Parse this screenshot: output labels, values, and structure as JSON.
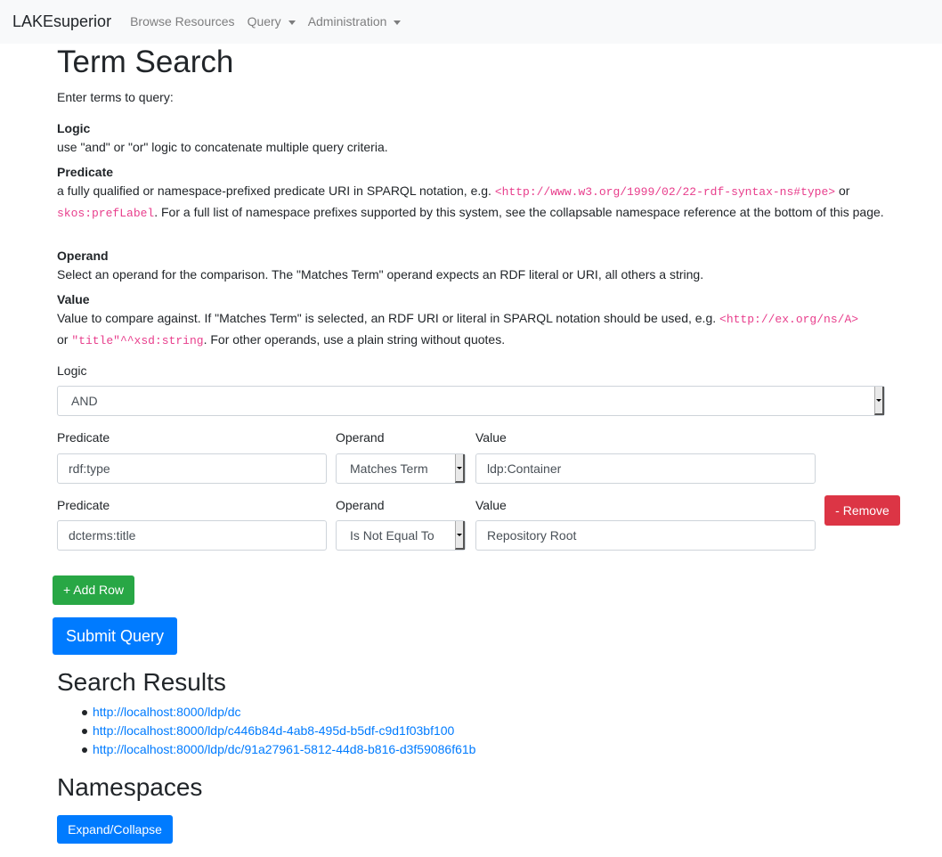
{
  "nav": {
    "brand": "LAKEsuperior",
    "browse": "Browse Resources",
    "query": "Query",
    "admin": "Administration"
  },
  "page": {
    "title": "Term Search",
    "intro": "Enter terms to query:"
  },
  "help": {
    "logic_term": "Logic",
    "logic_desc": "use \"and\" or \"or\" logic to concatenate multiple query criteria.",
    "predicate_term": "Predicate",
    "predicate_desc_1": "a fully qualified or namespace-prefixed predicate URI in SPARQL notation, e.g. ",
    "predicate_code_1": "<http://www.w3.org/1999/02/22-rdf-syntax-ns#type>",
    "predicate_desc_2": " or ",
    "predicate_code_2": "skos:prefLabel",
    "predicate_desc_3": ". For a full list of namespace prefixes supported by this system, see the collapsable namespace reference at the bottom of this page.",
    "operand_term": "Operand",
    "operand_desc": "Select an operand for the comparison. The \"Matches Term\" operand expects an RDF literal or URI, all others a string.",
    "value_term": "Value",
    "value_desc_1": "Value to compare against. If \"Matches Term\" is selected, an RDF URI or literal in SPARQL notation should be used, e.g. ",
    "value_code_1": "<http://ex.org/ns/A>",
    "value_desc_2": "or ",
    "value_code_2": "\"title\"^^xsd:string",
    "value_desc_3": ". For other operands, use a plain string without quotes."
  },
  "form": {
    "logic_label": "Logic",
    "logic_value": "AND",
    "predicate_label": "Predicate",
    "operand_label": "Operand",
    "value_label": "Value",
    "rows": [
      {
        "predicate": "rdf:type",
        "operand": "Matches Term",
        "value": "ldp:Container"
      },
      {
        "predicate": "dcterms:title",
        "operand": "Is Not Equal To",
        "value": "Repository Root"
      }
    ],
    "remove_label": "- Remove",
    "add_row_label": "+ Add Row",
    "submit_label": "Submit Query"
  },
  "results": {
    "heading": "Search Results",
    "items": [
      "http://localhost:8000/ldp/dc",
      "http://localhost:8000/ldp/c446b84d-4ab8-495d-b5df-c9d1f03bf100",
      "http://localhost:8000/ldp/dc/91a27961-5812-44d8-b816-d3f59086f61b"
    ]
  },
  "namespaces": {
    "heading": "Namespaces",
    "toggle_label": "Expand/Collapse"
  },
  "colors": {
    "primary": "#007bff",
    "success": "#28a745",
    "danger": "#dc3545",
    "code": "#e83e8c"
  }
}
